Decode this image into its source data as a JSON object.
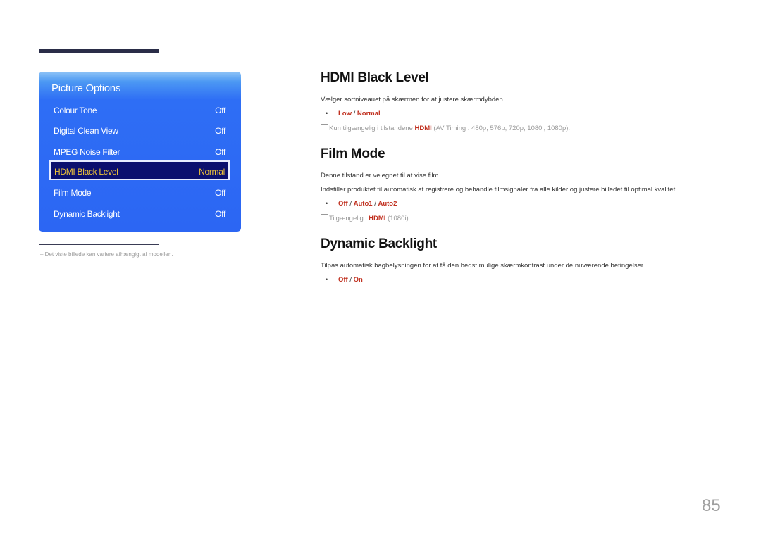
{
  "osd": {
    "title": "Picture Options",
    "items": [
      {
        "label": "Colour Tone",
        "value": "Off"
      },
      {
        "label": "Digital Clean View",
        "value": "Off"
      },
      {
        "label": "MPEG Noise Filter",
        "value": "Off"
      },
      {
        "label": "HDMI Black Level",
        "value": "Normal",
        "selected": true
      },
      {
        "label": "Film Mode",
        "value": "Off"
      },
      {
        "label": "Dynamic Backlight",
        "value": "Off"
      }
    ]
  },
  "footnote": "–  Det viste billede kan variere afhængigt af modellen.",
  "sections": {
    "hdmi": {
      "title": "HDMI Black Level",
      "desc": "Vælger sortniveauet på skærmen for at justere skærmdybden.",
      "opt1": "Low",
      "sep1": " / ",
      "opt2": "Normal",
      "note_pre": "Kun tilgængelig i tilstandene ",
      "note_hl": "HDMI",
      "note_post": " (AV Timing : 480p, 576p, 720p, 1080i, 1080p)."
    },
    "film": {
      "title": "Film Mode",
      "desc1": "Denne tilstand er velegnet til at vise film.",
      "desc2": "Indstiller produktet til automatisk at registrere og behandle filmsignaler fra alle kilder og justere billedet til optimal kvalitet.",
      "opt1": "Off",
      "sep1": " / ",
      "opt2": "Auto1",
      "sep2": " / ",
      "opt3": "Auto2",
      "note_pre": "Tilgængelig i ",
      "note_hl": "HDMI",
      "note_post": " (1080i)."
    },
    "backlight": {
      "title": "Dynamic Backlight",
      "desc": "Tilpas automatisk bagbelysningen for at få den bedst mulige skærmkontrast under de nuværende betingelser.",
      "opt1": "Off",
      "sep1": " / ",
      "opt2": "On"
    }
  },
  "bullet": "•",
  "page_number": "85"
}
